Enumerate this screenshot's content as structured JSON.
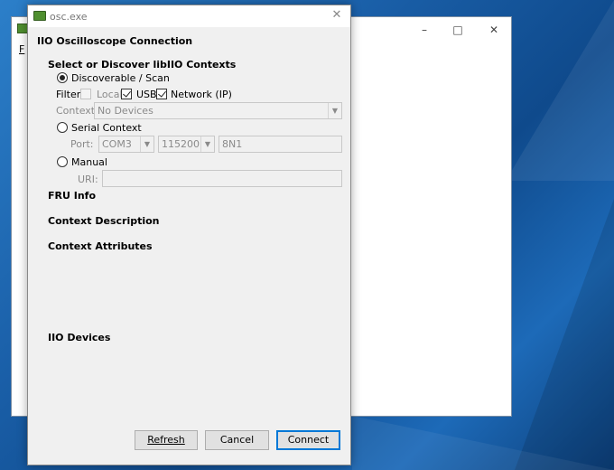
{
  "dialog": {
    "app_name": "osc.exe",
    "title": "IIO Oscilloscope Connection",
    "select_header": "Select or Discover libIIO Contexts",
    "discover_radio": "Discoverable / Scan",
    "filter_label": "Filter:",
    "filter_local": "Local",
    "filter_usb": "USB",
    "filter_network": "Network (IP)",
    "context_label": "Context:",
    "context_value": "No Devices",
    "serial_radio": "Serial Context",
    "port_label": "Port:",
    "port_value": "COM3",
    "baud_value": "115200",
    "serial_format": "8N1",
    "manual_radio": "Manual",
    "uri_label": "URI:",
    "uri_value": "",
    "fru_info": "FRU Info",
    "context_description": "Context Description",
    "context_attributes": "Context Attributes",
    "iio_devices": "IIO Devices",
    "refresh_label": "Refresh",
    "cancel_label": "Cancel",
    "connect_label": "Connect"
  },
  "background_window": {
    "menu_first_letter": "F"
  },
  "colors": {
    "desktop": "#1a5fa8",
    "dialog_bg": "#f0f0f0",
    "primary_border": "#0078d7",
    "app_icon": "#4f8f2f"
  },
  "icons": [
    "app-icon",
    "close-icon",
    "minimize-icon",
    "maximize-icon",
    "chevron-down-icon"
  ]
}
